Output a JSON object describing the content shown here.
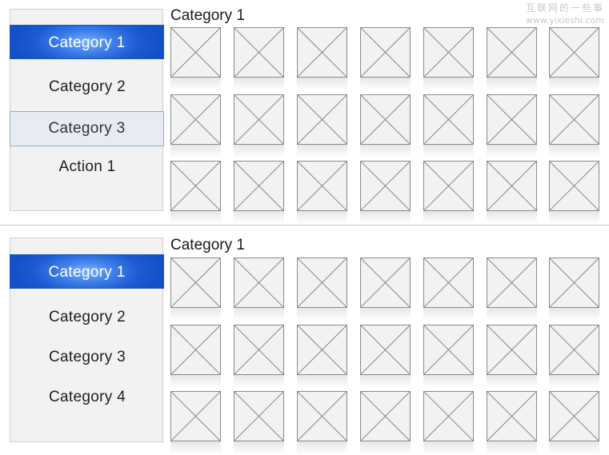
{
  "watermark": {
    "cn": "互联网的一些事",
    "url": "www.yixieshi.com"
  },
  "top_panel": {
    "section_title": "Category 1",
    "nav": [
      {
        "label": "Category 1",
        "state": "active"
      },
      {
        "label": "Category 2",
        "state": "normal"
      },
      {
        "label": "Category 3",
        "state": "hover"
      },
      {
        "label": "Action 1",
        "state": "normal"
      }
    ],
    "grid": {
      "rows": 3,
      "columns": 7,
      "item_icon": "image-placeholder-icon"
    }
  },
  "bottom_panel": {
    "section_title": "Category 1",
    "nav": [
      {
        "label": "Category 1",
        "state": "active"
      },
      {
        "label": "Category 2",
        "state": "normal"
      },
      {
        "label": "Category 3",
        "state": "normal"
      },
      {
        "label": "Category 4",
        "state": "normal"
      }
    ],
    "grid": {
      "rows": 3,
      "columns": 7,
      "item_icon": "image-placeholder-icon"
    }
  },
  "colors": {
    "active_start": "#7fb0ff",
    "active_end": "#1450c5",
    "hover_border": "#79b7c6",
    "sidebar_bg": "#f2f2f2",
    "thumb_border": "#8a8a8a"
  }
}
